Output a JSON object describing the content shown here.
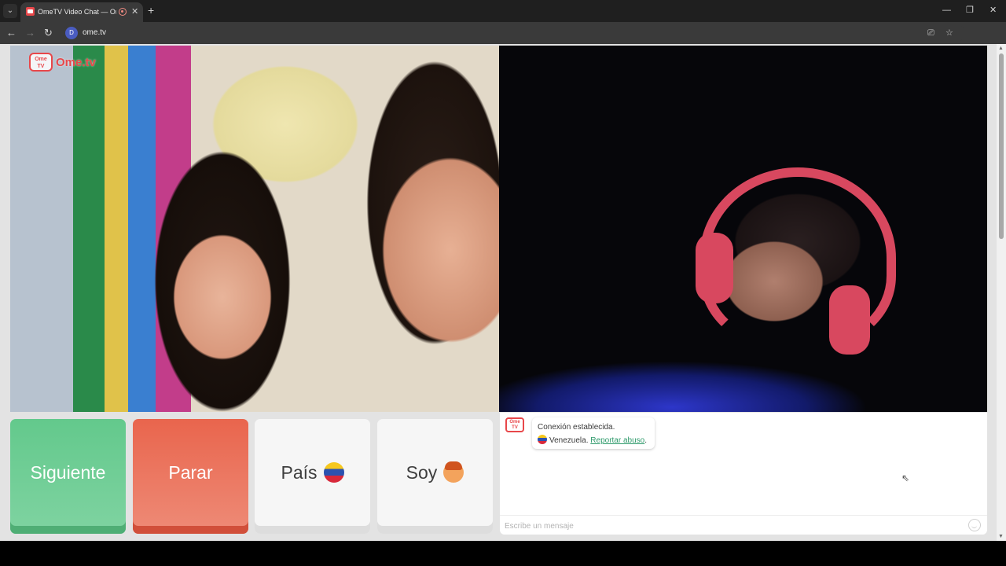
{
  "browser": {
    "tab_list_icon": "chevron-down-icon",
    "tab": {
      "title": "OmeTV Video Chat — Ome",
      "close": "✕"
    },
    "new_tab": "+",
    "window": {
      "minimize": "—",
      "maximize": "❐",
      "close": "✕"
    },
    "nav": {
      "back": "←",
      "forward": "→",
      "reload": "↻"
    },
    "url": "ome.tv",
    "site_icon_text": "D",
    "omni": {
      "cast": "⎚",
      "star": "☆"
    },
    "extensions_icon": "⚇",
    "menu_icon": "⋮"
  },
  "logo": {
    "tv_label": "Ome TV",
    "text": "Ome.tv"
  },
  "buttons": {
    "next": "Siguiente",
    "stop": "Parar",
    "country": "País",
    "gender": "Soy"
  },
  "chat": {
    "avatar_label": "Ome TV",
    "system_message": "Conexión establecida.",
    "country": "Venezuela.",
    "report_link": "Reportar abuso",
    "report_suffix": ".",
    "input_placeholder": "Escribe un mensaje"
  },
  "colors": {
    "next": "#63c98c",
    "stop": "#e9654d",
    "brand": "#e8474a",
    "link": "#2e9a6b"
  }
}
